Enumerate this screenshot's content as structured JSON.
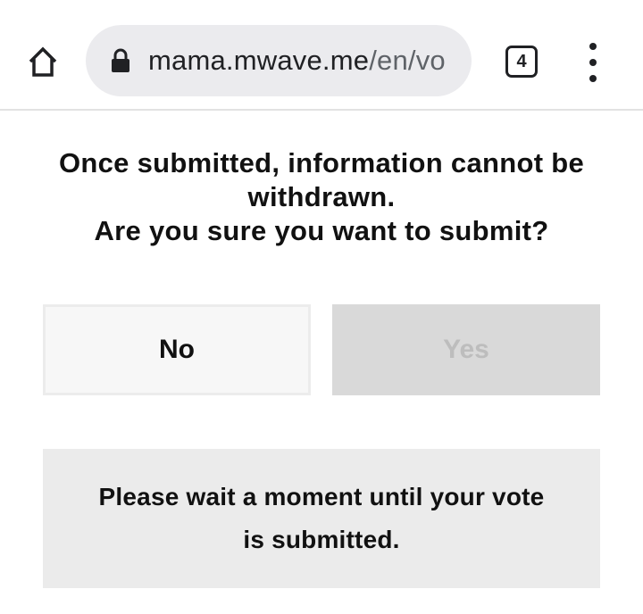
{
  "browser": {
    "url_host": "mama.mwave.me",
    "url_path": "/en/vo",
    "tab_count": "4"
  },
  "dialog": {
    "message_line1": "Once submitted, information cannot be withdrawn.",
    "message_line2": "Are you sure you want to submit?",
    "no_label": "No",
    "yes_label": "Yes",
    "yes_disabled": true,
    "wait_message": "Please wait a moment until your vote is submitted."
  },
  "colors": {
    "yes_button_bg": "#d9d9d9",
    "yes_button_text": "#bdbdbd",
    "no_button_bg": "#f7f7f7",
    "wait_box_bg": "#ebebeb"
  }
}
